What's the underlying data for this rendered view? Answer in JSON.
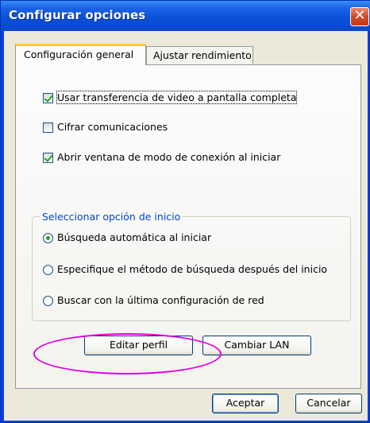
{
  "window": {
    "title": "Configurar opciones",
    "close_symbol": "✕"
  },
  "tabs": [
    {
      "label": "Configuración general",
      "active": true
    },
    {
      "label": "Ajustar rendimiento",
      "active": false
    }
  ],
  "options": {
    "fullscreen_video": {
      "label": "Usar transferencia de video a pantalla completa",
      "checked": true
    },
    "encrypt": {
      "label": "Cifrar comunicaciones",
      "checked": false
    },
    "open_connection_mode": {
      "label": "Abrir ventana de modo de conexión al iniciar",
      "checked": true
    }
  },
  "startup_group": {
    "title": "Seleccionar opción de inicio",
    "options": [
      {
        "label": "Búsqueda automática al iniciar",
        "selected": true
      },
      {
        "label": "Especifique el método de búsqueda después del inicio",
        "selected": false
      },
      {
        "label": "Buscar con la última configuración de red",
        "selected": false
      }
    ]
  },
  "buttons": {
    "edit_profile": "Editar perfil",
    "change_lan": "Cambiar LAN",
    "ok": "Aceptar",
    "cancel": "Cancelar"
  },
  "colors": {
    "titlebar": "#0a50d8",
    "dialog_bg": "#ece9d8",
    "active_tab_accent": "#ffc83c",
    "group_title": "#0046d5",
    "highlight_ellipse": "#e000e0",
    "check_green": "#21a121"
  }
}
